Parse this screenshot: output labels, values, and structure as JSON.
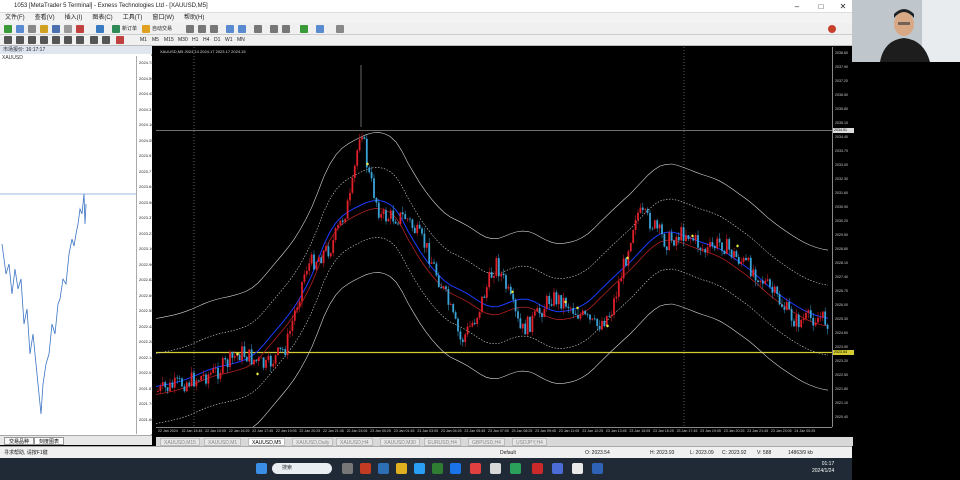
{
  "window": {
    "title": "1053 [MetaTrader 5 Terminal] - Exness Technologies Ltd - [XAUUSD,M5]",
    "minimize": "–",
    "maximize": "□",
    "close": "✕"
  },
  "menu": [
    "文件(F)",
    "查看(V)",
    "插入(I)",
    "图表(C)",
    "工具(T)",
    "窗口(W)",
    "帮助(H)"
  ],
  "toolbar": {
    "new_order": "新订单",
    "auto_trading": "自动交易",
    "timeframes": [
      "M1",
      "M5",
      "M15",
      "M30",
      "H1",
      "H4",
      "D1",
      "W1",
      "MN"
    ]
  },
  "left_panel": {
    "header": "市场报价: 16:17:17",
    "symbol": "XAUUSD",
    "scale": [
      "2024.72",
      "2024.59",
      "2024.45",
      "2024.31",
      "2024.18",
      "2024.05",
      "2023.91",
      "2023.77",
      "2023.64",
      "2023.50",
      "2023.37",
      "2023.23",
      "2023.10",
      "2022.96",
      "2022.82",
      "2022.69",
      "2022.55",
      "2022.42",
      "2022.28",
      "2022.14",
      "2022.01",
      "2021.87",
      "2021.74",
      "2021.60"
    ],
    "tabs": [
      "交易品种",
      "刻度图表"
    ]
  },
  "chart": {
    "title": "XAUUSD,M5  2024.14 2024.17 2023.17 2024.15",
    "price_labels": [
      "2038.60",
      "2037.90",
      "2037.20",
      "2036.50",
      "2035.80",
      "2035.10",
      "2034.40",
      "2033.70",
      "2033.00",
      "2032.30",
      "2031.60",
      "2030.90",
      "2030.20",
      "2029.50",
      "2028.80",
      "2028.10",
      "2027.40",
      "2026.70",
      "2026.00",
      "2025.30",
      "2024.60",
      "2023.90",
      "2023.20",
      "2022.50",
      "2021.80",
      "2021.10",
      "2020.40"
    ],
    "current_price_tag": "2023.54",
    "upper_line_tag": "2034.51",
    "time_labels": [
      "22 Jan 2024",
      "22 Jan 13:45",
      "22 Jan 15:05",
      "22 Jan 16:25",
      "22 Jan 17:45",
      "22 Jan 19:05",
      "22 Jan 20:25",
      "22 Jan 21:45",
      "22 Jan 23:05",
      "23 Jan 00:25",
      "23 Jan 01:45",
      "23 Jan 03:05",
      "23 Jan 04:25",
      "23 Jan 05:45",
      "23 Jan 07:05",
      "23 Jan 08:25",
      "23 Jan 09:45",
      "23 Jan 11:05",
      "23 Jan 12:25",
      "23 Jan 13:45",
      "23 Jan 15:05",
      "23 Jan 16:25",
      "23 Jan 17:45",
      "23 Jan 19:05",
      "23 Jan 20:25",
      "23 Jan 21:45",
      "23 Jan 23:05",
      "24 Jan 00:25"
    ],
    "colors": {
      "bull": "#e0202a",
      "bear": "#3aa3d8",
      "ma_fast": "#1a3cff",
      "ma_slow": "#b02020",
      "band": "#d8d8d8",
      "signal": "#e8e840",
      "hline": "#d4cc30"
    }
  },
  "chart_tabs": [
    "XAUUSD,M15",
    "XAUUSD,M1",
    "XAUUSD,M5",
    "XAUUSD,Daily",
    "XAUUSD,H4",
    "XAUUSD,M30",
    "EURUSD,H4",
    "GBPUSD,H4",
    "USDJPY,H4"
  ],
  "active_chart_tab": 2,
  "status": {
    "help": "寻求帮助, 请按F1键",
    "profile": "Default",
    "time": "2024.01.24 01:35",
    "open": "O: 2023.54",
    "high": "H: 2023.93",
    "low": "L: 2023.09",
    "close": "C: 2023.92",
    "volume": "V: 588",
    "traffic": "14863/9 kb"
  },
  "taskbar": {
    "search_placeholder": "搜索",
    "clock_time": "01:17",
    "clock_date": "2024/1/24"
  }
}
